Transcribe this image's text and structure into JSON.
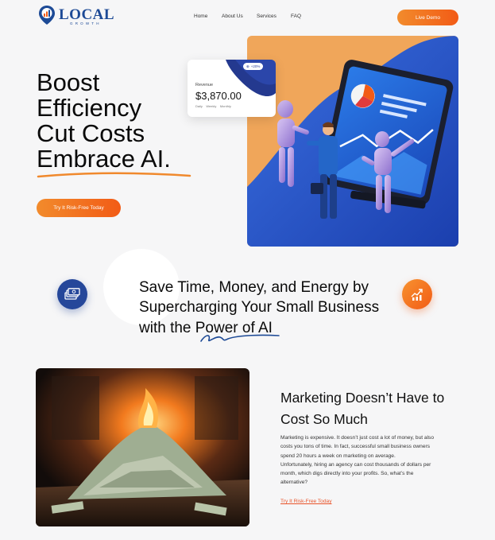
{
  "brand": {
    "name": "LOCAL",
    "tagline": "GROWTH",
    "colors": {
      "primary": "#1d4a96",
      "accent": "#f25b16",
      "accent_light": "#f28b2c"
    }
  },
  "nav": {
    "items": [
      "Home",
      "About Us",
      "Services",
      "FAQ"
    ],
    "cta_label": "Live Demo"
  },
  "hero": {
    "headline_lines": [
      "Boost",
      "Efficiency",
      "Cut Costs",
      "Embrace AI."
    ],
    "cta_label": "Try It Risk-Free Today",
    "image_icon": "ai-robots-handshake-illustration"
  },
  "revenue_card": {
    "badge": "+20%",
    "label": "Revenue",
    "value": "$3,870.00",
    "tabs": [
      "Daily",
      "Weekly",
      "Monthly"
    ]
  },
  "value_section": {
    "lines": [
      "Save Time, Money, and Energy by",
      "Supercharging Your Small Business",
      "with the Power of AI"
    ],
    "left_icon": "money-stack-icon",
    "right_icon": "growth-chart-icon"
  },
  "marketing": {
    "title_lines": [
      "Marketing Doesn’t Have to",
      "Cost So Much"
    ],
    "body_lines": [
      "Marketing is expensive. It doesn’t just cost a lot of money, but also",
      "costs you tons of time. In fact, successful small business owners",
      "spend 20 hours a week on marketing on average.",
      "Unfortunately, hiring an agency can cost thousands of dollars per",
      "month, which digs directly into your profits. So, what’s the",
      "alternative?"
    ],
    "link_label": "Try It Risk-Free Today",
    "image_icon": "burning-money-pile-photo"
  }
}
